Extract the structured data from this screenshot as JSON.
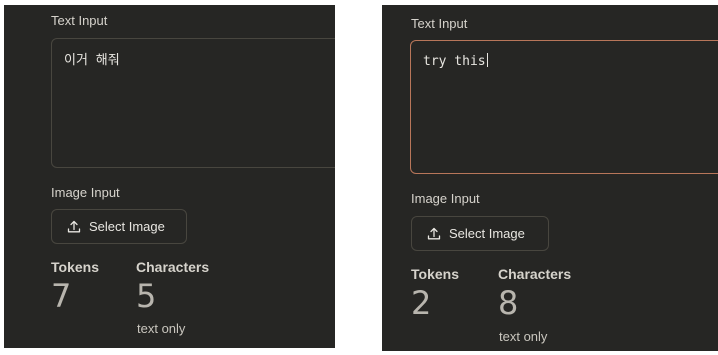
{
  "left": {
    "text_input_label": "Text Input",
    "text_value": "이거 해줘",
    "image_input_label": "Image Input",
    "select_image_label": "Select Image",
    "tokens_label": "Tokens",
    "tokens_value": "7",
    "characters_label": "Characters",
    "characters_value": "5",
    "characters_note": "text only"
  },
  "right": {
    "text_input_label": "Text Input",
    "text_value": "try this",
    "image_input_label": "Image Input",
    "select_image_label": "Select Image",
    "tokens_label": "Tokens",
    "tokens_value": "2",
    "characters_label": "Characters",
    "characters_value": "8",
    "characters_note": "text only"
  },
  "colors": {
    "panel_bg": "#262624",
    "border": "#48463f",
    "focus_border": "#b8765a",
    "text": "#e8e6e1"
  },
  "icons": {
    "select_image": "upload-icon"
  }
}
